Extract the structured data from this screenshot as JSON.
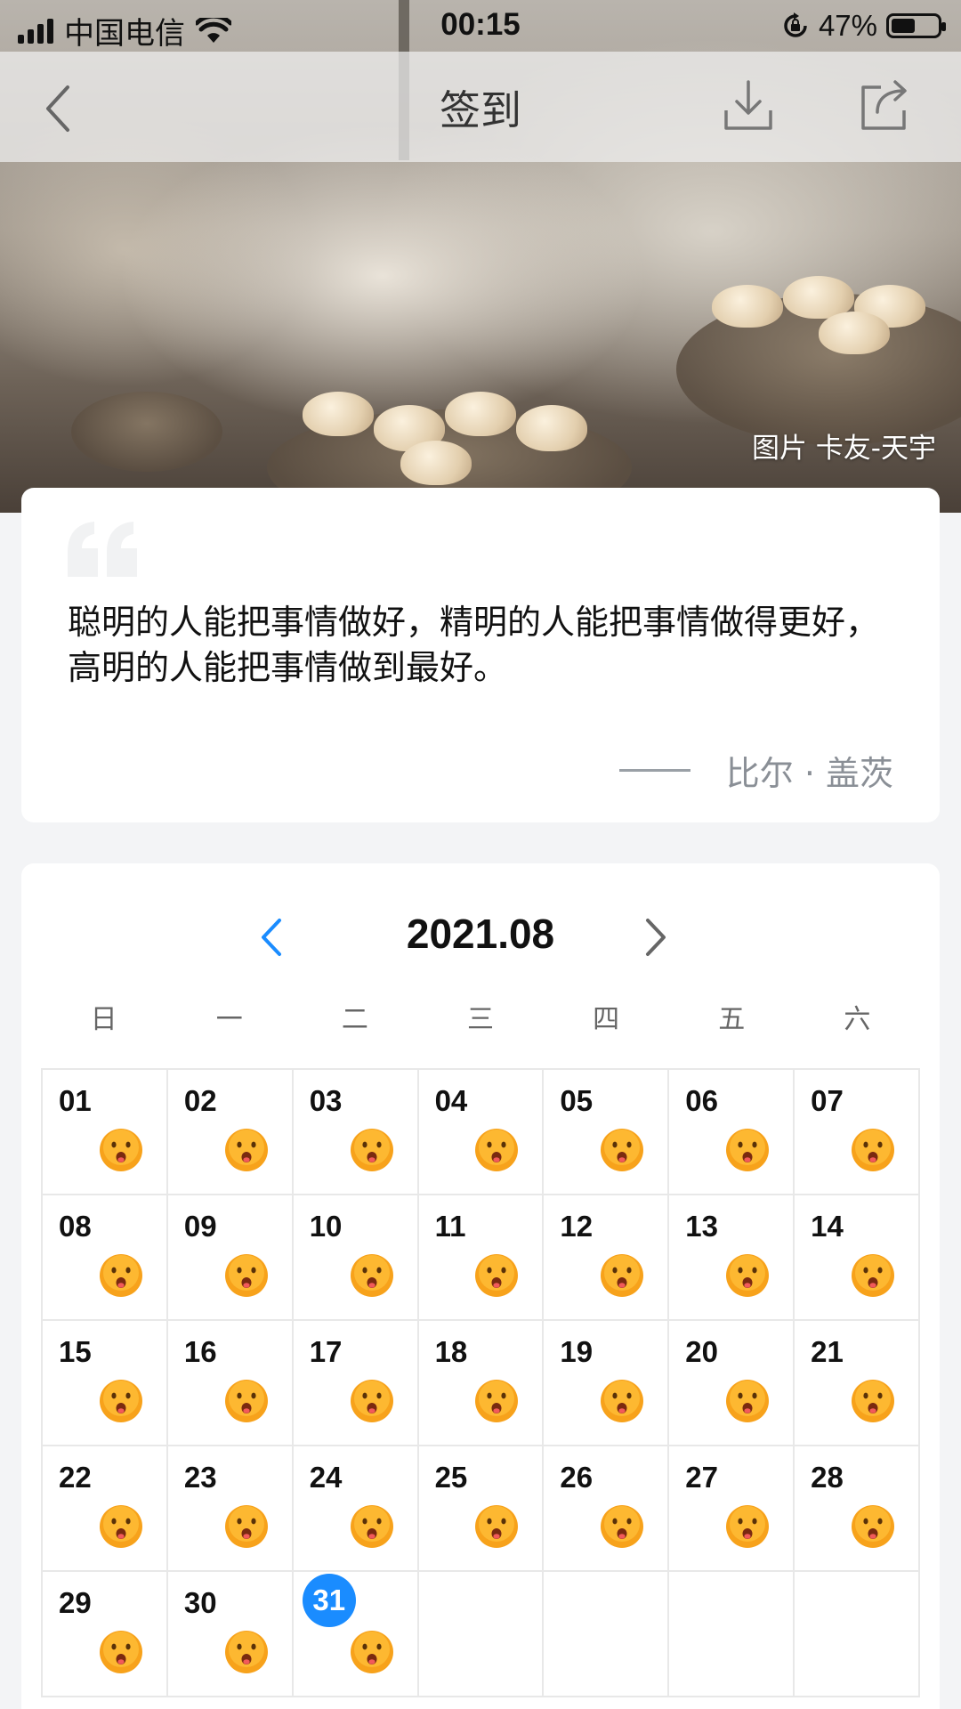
{
  "status_bar": {
    "carrier": "中国电信",
    "time": "00:15",
    "battery_text": "47%",
    "battery_level": 0.47
  },
  "nav": {
    "title": "签到",
    "icons": [
      "back-arrow-icon",
      "download-icon",
      "share-icon"
    ]
  },
  "hero": {
    "credit": "图片 卡友-天宇"
  },
  "quote": {
    "text": "聪明的人能把事情做好，精明的人能把事情做得更好，高明的人能把事情做到最好。",
    "author": "比尔 · 盖茨"
  },
  "calendar": {
    "month": "2021.08",
    "weekdays": [
      "日",
      "一",
      "二",
      "三",
      "四",
      "五",
      "六"
    ],
    "days": [
      "01",
      "02",
      "03",
      "04",
      "05",
      "06",
      "07",
      "08",
      "09",
      "10",
      "11",
      "12",
      "13",
      "14",
      "15",
      "16",
      "17",
      "18",
      "19",
      "20",
      "21",
      "22",
      "23",
      "24",
      "25",
      "26",
      "27",
      "28",
      "29",
      "30",
      "31"
    ],
    "today": "31",
    "checked_in_icon": "smiley-face-icon",
    "colors": {
      "accent": "#1a8cff",
      "emoji": "#f7a21b"
    }
  }
}
